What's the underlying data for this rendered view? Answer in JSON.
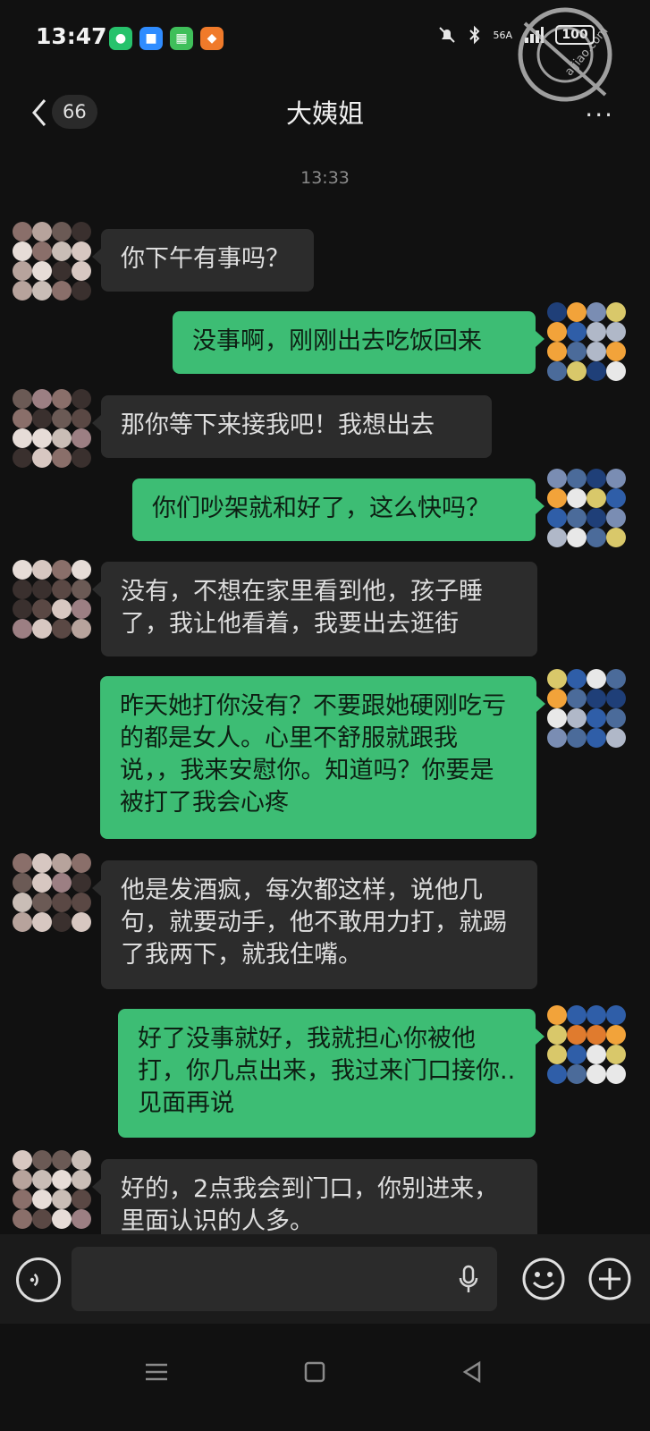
{
  "status_bar": {
    "time": "13:47",
    "network": "56A",
    "battery": "100"
  },
  "header": {
    "unread_count": "66",
    "title": "大姨姐",
    "more": "···"
  },
  "watermark": {
    "text": "aijiao.com 角社区"
  },
  "timestamp": "13:33",
  "messages": [
    {
      "side": "in",
      "text": "你下午有事吗？"
    },
    {
      "side": "out",
      "text": "没事啊，刚刚出去吃饭回来"
    },
    {
      "side": "in",
      "text": "那你等下来接我吧！我想出去"
    },
    {
      "side": "out",
      "text": "你们吵架就和好了，这么快吗？"
    },
    {
      "side": "in",
      "text": "没有，不想在家里看到他，孩子睡了，我让他看着，我要出去逛街"
    },
    {
      "side": "out",
      "text": "昨天她打你没有？不要跟她硬刚吃亏的都是女人。心里不舒服就跟我说，，我来安慰你。知道吗？你要是被打了我会心疼"
    },
    {
      "side": "in",
      "text": "他是发酒疯，每次都这样，说他几句，就要动手，他不敢用力打，就踢了我两下，就我住嘴。"
    },
    {
      "side": "out",
      "text": "好了没事就好，我就担心你被他打，你几点出来，我过来门口接你..见面再说"
    },
    {
      "side": "in",
      "text": "好的，2点我会到门口，你别进来，里面认识的人多。"
    }
  ],
  "colors": {
    "background": "#111111",
    "incoming_bubble": "#2c2c2c",
    "outgoing_bubble": "#3dbd74"
  },
  "icons": {
    "back": "chevron-left-icon",
    "voice": "voice-icon",
    "mic": "mic-icon",
    "emoji": "emoji-icon",
    "plus": "plus-icon",
    "nav_menu": "menu-icon",
    "nav_home": "square-icon",
    "nav_back": "triangle-back-icon"
  }
}
